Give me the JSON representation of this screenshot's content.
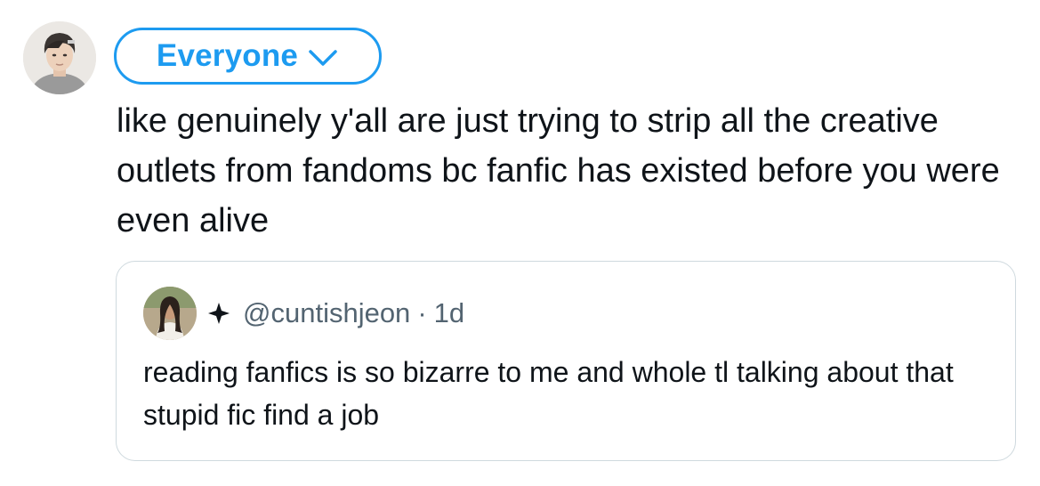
{
  "composer": {
    "audience": {
      "label": "Everyone",
      "icon": "chevron-down-icon",
      "color": "#1d9bf0"
    },
    "text": "like genuinely y'all are just trying to strip all the creative outlets from fandoms bc fanfic has existed before you were even alive"
  },
  "quoted_post": {
    "badge_icon": "sparkle-icon",
    "handle": "@cuntishjeon",
    "separator": "·",
    "time": "1d",
    "text": "reading fanfics is so bizarre to me and whole tl talking about that stupid fic find a job"
  }
}
